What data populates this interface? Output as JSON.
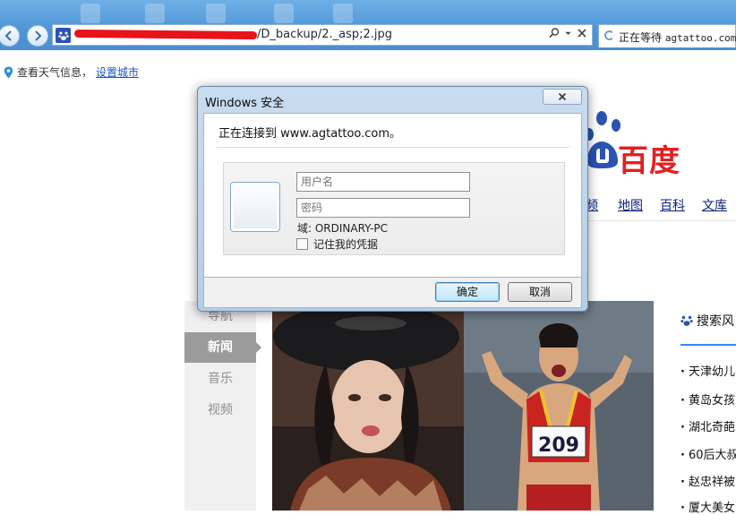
{
  "browser": {
    "address_url_suffix": "/D_backup/2._asp;2.jpg",
    "tab_title_prefix": "正在等待",
    "tab_title_domain": "agtattoo.com"
  },
  "weather": {
    "text": "查看天气信息，",
    "link": "设置城市"
  },
  "baidu": {
    "logo_text": "百度",
    "nav": [
      "频",
      "地图",
      "百科",
      "文库"
    ]
  },
  "left_nav": {
    "items": [
      {
        "label": "导航",
        "active": false
      },
      {
        "label": "新闻",
        "active": true
      },
      {
        "label": "音乐",
        "active": false
      },
      {
        "label": "视频",
        "active": false
      }
    ]
  },
  "hot_list": {
    "title": "搜索风",
    "items": [
      "天津幼儿",
      "黄岛女孩",
      "湖北奇葩",
      "60后大叔",
      "赵忠祥被",
      "厦大美女"
    ]
  },
  "photo_caption": {
    "bib_number": "209"
  },
  "dialog": {
    "title": "Windows 安全",
    "connecting": "正在连接到 www.agtattoo.com。",
    "username_placeholder": "用户名",
    "password_placeholder": "密码",
    "domain": "域: ORDINARY-PC",
    "remember": "记住我的凭据",
    "ok": "确定",
    "cancel": "取消"
  },
  "colors": {
    "accent_blue": "#4e95d6",
    "baidu_red": "#e02020",
    "baidu_blue": "#2b52b4",
    "link_blue": "#1a55c9"
  }
}
